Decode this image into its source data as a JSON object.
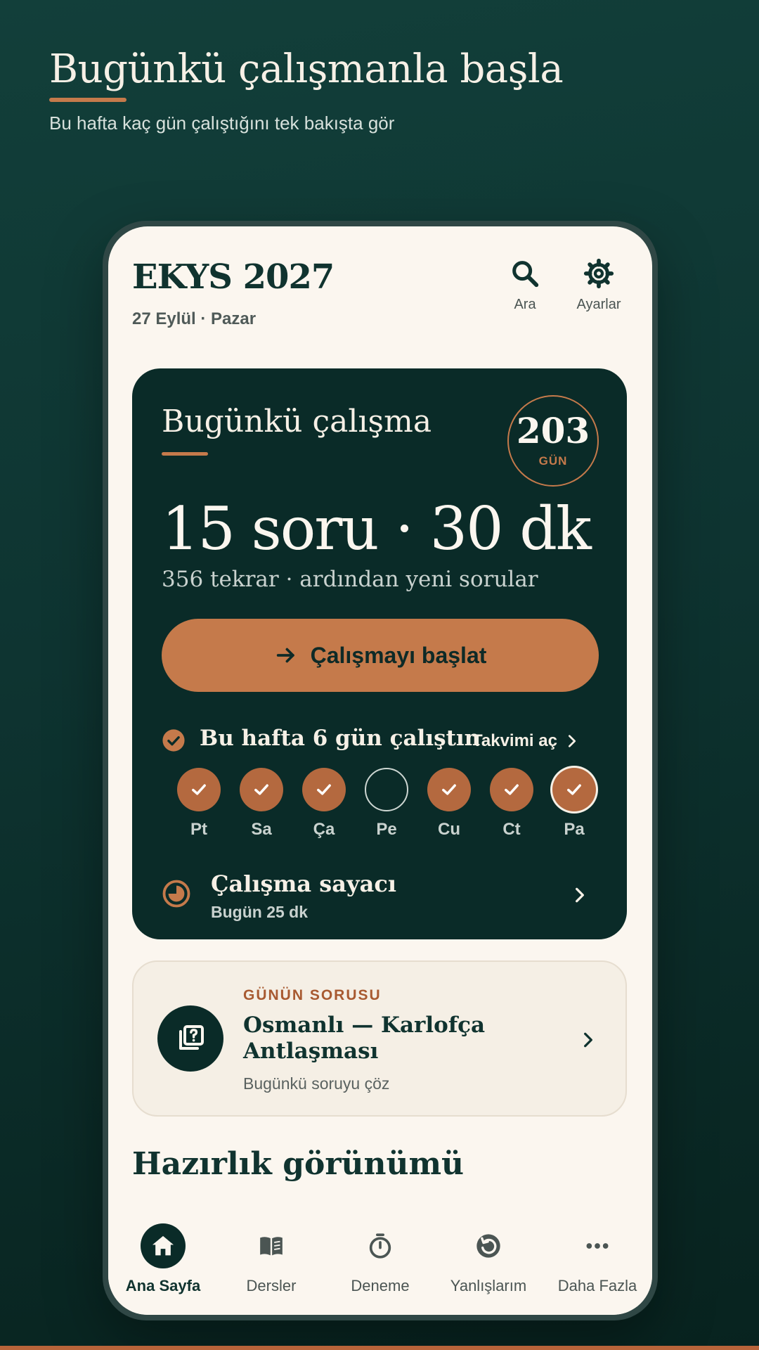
{
  "hero": {
    "title": "Bugünkü çalışmanla başla",
    "subtitle": "Bu hafta kaç gün çalıştığını tek bakışta gör"
  },
  "app": {
    "title": "EKYS 2027",
    "date": "27 Eylül · Pazar",
    "actions": {
      "search_label": "Ara",
      "settings_label": "Ayarlar"
    }
  },
  "today": {
    "title": "Bugünkü çalışma",
    "days_left": "203",
    "days_unit": "GÜN",
    "plan_main": "15 soru · 30 dk",
    "plan_sub": "356 tekrar · ardından yeni sorular",
    "start_label": "Çalışmayı başlat",
    "week_summary": "Bu hafta 6 gün çalıştın",
    "calendar_label": "Takvimi aç",
    "week_days": [
      {
        "label": "Pt",
        "status": "done"
      },
      {
        "label": "Sa",
        "status": "done"
      },
      {
        "label": "Ça",
        "status": "done"
      },
      {
        "label": "Pe",
        "status": "missed"
      },
      {
        "label": "Cu",
        "status": "done"
      },
      {
        "label": "Ct",
        "status": "done"
      },
      {
        "label": "Pa",
        "status": "done-today"
      }
    ],
    "timer_title": "Çalışma sayacı",
    "timer_sub": "Bugün 25 dk"
  },
  "qotd": {
    "kicker": "GÜNÜN SORUSU",
    "title": "Osmanlı — Karlofça Antlaşması",
    "subtitle": "Bugünkü soruyu çöz"
  },
  "section": {
    "title": "Hazırlık görünümü"
  },
  "nav": {
    "items": [
      {
        "label": "Ana Sayfa",
        "icon": "home-icon",
        "active": true
      },
      {
        "label": "Dersler",
        "icon": "book-icon",
        "active": false
      },
      {
        "label": "Deneme",
        "icon": "stopwatch-icon",
        "active": false
      },
      {
        "label": "Yanlışlarım",
        "icon": "history-icon",
        "active": false
      },
      {
        "label": "Daha Fazla",
        "icon": "more-icon",
        "active": false
      }
    ]
  },
  "colors": {
    "background": "#0e3431",
    "card_dark": "#0a2b28",
    "accent": "#c57a4b",
    "surface": "#fbf6ef"
  }
}
